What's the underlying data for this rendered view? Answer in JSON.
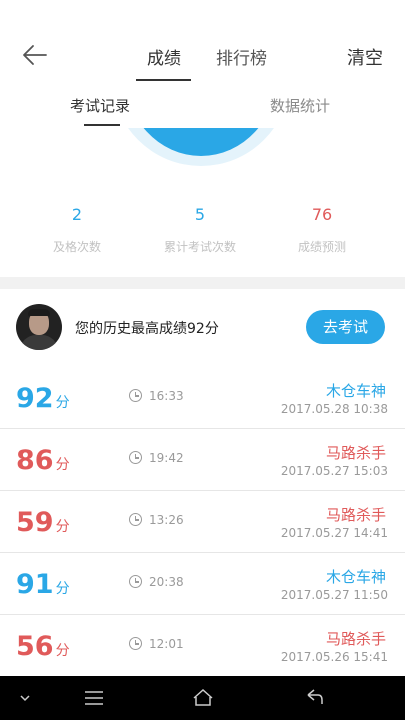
{
  "header": {
    "tabs": [
      {
        "label": "成绩",
        "active": true
      },
      {
        "label": "排行榜",
        "active": false
      }
    ],
    "clear_label": "清空",
    "back_icon": "arrow-left-icon"
  },
  "subtabs": [
    {
      "label": "考试记录",
      "active": true
    },
    {
      "label": "数据统计",
      "active": false
    }
  ],
  "stats": [
    {
      "value": "2",
      "label": "及格次数",
      "color": "#2aa7e6"
    },
    {
      "value": "5",
      "label": "累计考试次数",
      "color": "#2aa7e6"
    },
    {
      "value": "76",
      "label": "成绩预测",
      "color": "#e05a5a"
    }
  ],
  "best": {
    "text": "您的历史最高成绩92分",
    "button_label": "去考试"
  },
  "records": [
    {
      "score": "92",
      "unit": "分",
      "duration": "16:33",
      "title": "木仓车神",
      "date": "2017.05.28   10:38",
      "color": "#2aa7e6"
    },
    {
      "score": "86",
      "unit": "分",
      "duration": "19:42",
      "title": "马路杀手",
      "date": "2017.05.27   15:03",
      "color": "#e05a5a"
    },
    {
      "score": "59",
      "unit": "分",
      "duration": "13:26",
      "title": "马路杀手",
      "date": "2017.05.27   14:41",
      "color": "#e05a5a"
    },
    {
      "score": "91",
      "unit": "分",
      "duration": "20:38",
      "title": "木仓车神",
      "date": "2017.05.27   11:50",
      "color": "#2aa7e6"
    },
    {
      "score": "56",
      "unit": "分",
      "duration": "12:01",
      "title": "马路杀手",
      "date": "2017.05.26   15:41",
      "color": "#e05a5a"
    }
  ],
  "colors": {
    "accent": "#2aa7e6",
    "fail": "#e05a5a"
  }
}
